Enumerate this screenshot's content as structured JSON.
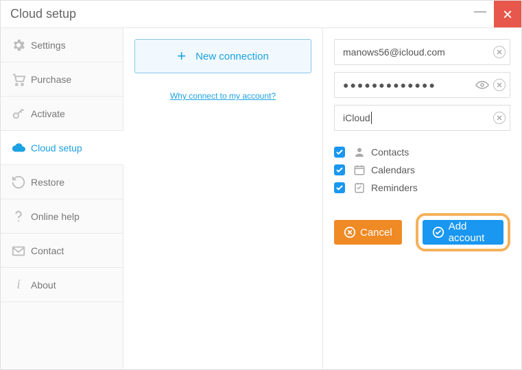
{
  "title": "Cloud setup",
  "sidebar": {
    "items": [
      {
        "key": "settings",
        "label": "Settings"
      },
      {
        "key": "purchase",
        "label": "Purchase"
      },
      {
        "key": "activate",
        "label": "Activate"
      },
      {
        "key": "cloudsetup",
        "label": "Cloud setup",
        "active": true
      },
      {
        "key": "restore",
        "label": "Restore"
      },
      {
        "key": "onlinehelp",
        "label": "Online help"
      },
      {
        "key": "contact",
        "label": "Contact"
      },
      {
        "key": "about",
        "label": "About"
      }
    ]
  },
  "middle": {
    "new_connection_label": "New connection",
    "why_link": "Why connect to my account?"
  },
  "form": {
    "email": {
      "value": "manows56@icloud.com"
    },
    "password": {
      "masked": "●●●●●●●●●●●●●"
    },
    "name": {
      "value": "iCloud"
    },
    "sync": {
      "contacts": {
        "label": "Contacts",
        "checked": true
      },
      "calendars": {
        "label": "Calendars",
        "checked": true
      },
      "reminders": {
        "label": "Reminders",
        "checked": true
      }
    },
    "cancel_label": "Cancel",
    "add_label": "Add account"
  }
}
